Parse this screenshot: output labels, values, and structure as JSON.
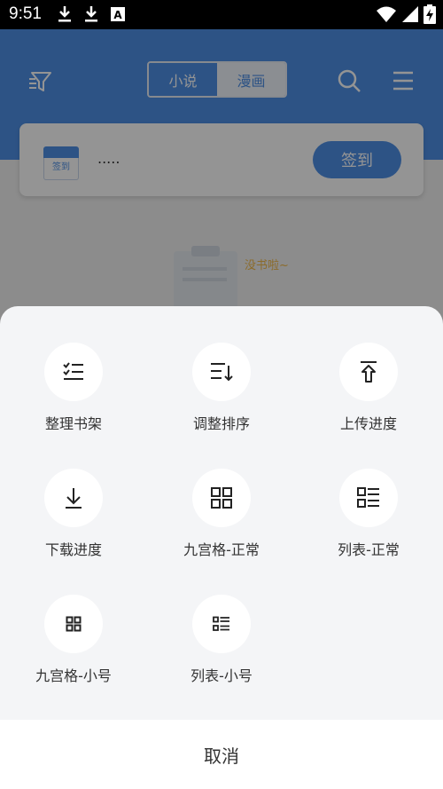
{
  "status_bar": {
    "time": "9:51",
    "icons": [
      "download-icon",
      "download-icon",
      "a-box-icon",
      "wifi-icon",
      "signal-icon",
      "battery-charging-icon"
    ]
  },
  "header": {
    "tabs": [
      {
        "label": "小说",
        "active": true
      },
      {
        "label": "漫画",
        "active": false
      }
    ],
    "icons": [
      "filter-icon",
      "search-icon",
      "menu-icon"
    ]
  },
  "signin_card": {
    "calendar_label": "签到",
    "text": ".....",
    "button_label": "签到"
  },
  "empty_state": {
    "text": "没书啦~"
  },
  "sheet": {
    "items": [
      {
        "label": "整理书架",
        "icon": "checklist-icon"
      },
      {
        "label": "调整排序",
        "icon": "sort-icon"
      },
      {
        "label": "上传进度",
        "icon": "upload-icon"
      },
      {
        "label": "下载进度",
        "icon": "download-arrow-icon"
      },
      {
        "label": "九宫格-正常",
        "icon": "grid-icon"
      },
      {
        "label": "列表-正常",
        "icon": "list-icon"
      },
      {
        "label": "九宫格-小号",
        "icon": "grid-small-icon"
      },
      {
        "label": "列表-小号",
        "icon": "list-small-icon"
      }
    ],
    "cancel_label": "取消"
  },
  "colors": {
    "brand": "#4f90e6",
    "sheet_background": "#f4f5f7",
    "status_bar": "#000000"
  }
}
